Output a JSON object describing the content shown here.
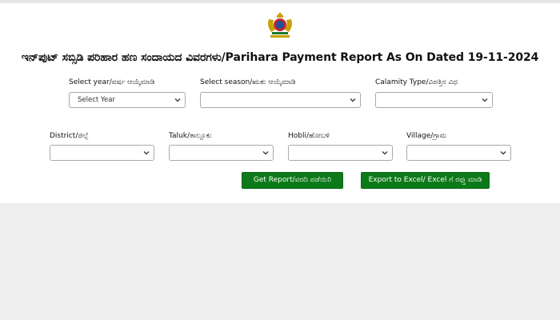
{
  "header": {
    "title": "ಇನ್‌ಪುಟ್ ಸಬ್ಸಿಡಿ ಪರಿಹಾರ ಹಣ ಸಂದಾಯದ ವಿವರಗಳು/Parihara Payment Report As On Dated 19-11-2024",
    "emblem_icon": "karnataka-emblem-icon"
  },
  "filters": {
    "year": {
      "label": "Select year/ವರ್ಷ ಆಯ್ಕೆಮಾಡಿ",
      "value": "Select Year"
    },
    "season": {
      "label": "Select season/ಋತು ಆಯ್ಕೆಮಾಡಿ",
      "value": ""
    },
    "calamity": {
      "label": "Calamity Type/ವಿಪತ್ತಿನ ವಿಧ",
      "value": ""
    },
    "district": {
      "label": "District/ಜಿಲ್ಲೆ",
      "value": ""
    },
    "taluk": {
      "label": "Taluk/ತಾಲ್ಲೂಕು",
      "value": ""
    },
    "hobli": {
      "label": "Hobli/ಹೋಬಳಿ",
      "value": ""
    },
    "village": {
      "label": "Village/ಗ್ರಾಮ",
      "value": ""
    }
  },
  "actions": {
    "get_report": "Get Report/ವರದಿ ಪಡೆಯಿರಿ",
    "export_excel": "Export to Excel/ Excel ಗೆ ರಫ್ತು ಮಾಡಿ"
  },
  "colors": {
    "button_green": "#0c7a18",
    "page_background": "#eeeeee",
    "panel_background": "#ffffff"
  }
}
